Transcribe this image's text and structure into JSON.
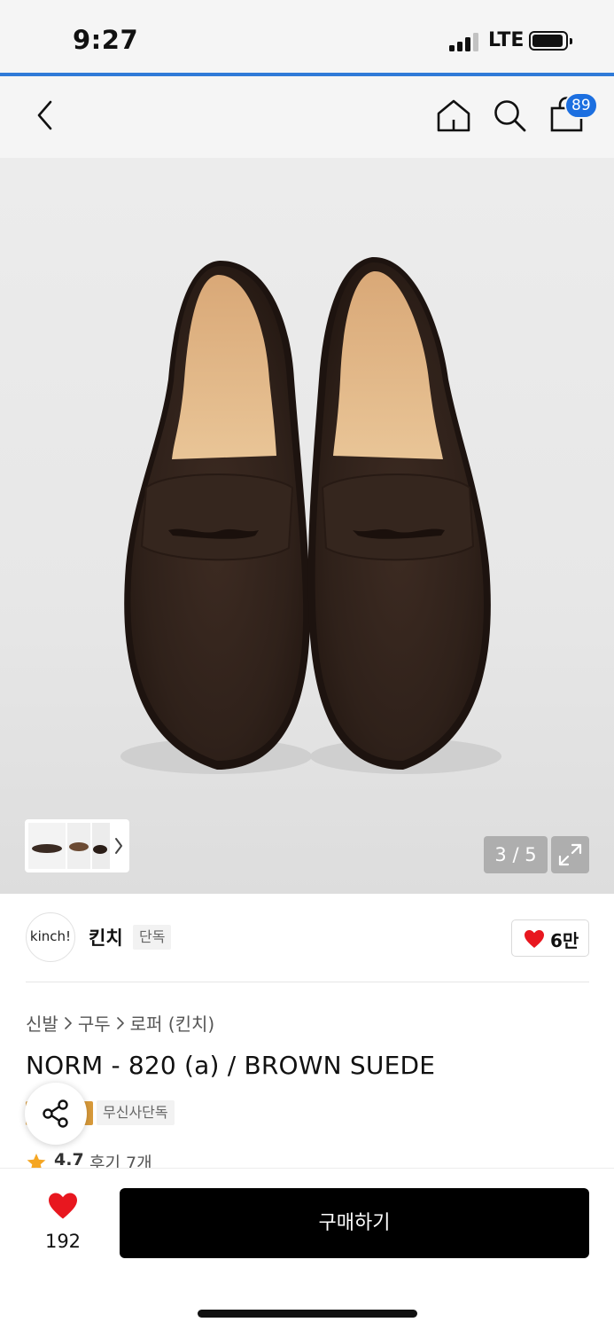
{
  "status_bar": {
    "time": "9:27",
    "network": "LTE"
  },
  "nav": {
    "cart_count": "89"
  },
  "product_image": {
    "counter": "3 / 5"
  },
  "brand": {
    "logo_text": "kinch!",
    "name": "킨치",
    "exclusive_tag": "단독",
    "likes": "6만"
  },
  "breadcrumb": [
    "신발",
    "구두",
    "로퍼 (킨치)"
  ],
  "product": {
    "title": "NORM - 820 (a) / BROWN SUEDE",
    "tag_musinsa": "무신사단독",
    "rating": "4.7",
    "reviews": "후기 7개"
  },
  "bottom_bar": {
    "wish_count": "192",
    "buy_label": "구매하기"
  },
  "colors": {
    "accent": "#1c6fe0",
    "heart": "#e8171f",
    "buy_button": "#000000",
    "tag_orange": "#d89a3a",
    "star": "#f5a623"
  },
  "icons": [
    "back-arrow-icon",
    "home-icon",
    "search-icon",
    "shopping-bag-icon",
    "chevron-right-icon",
    "expand-icon",
    "heart-icon",
    "share-icon",
    "star-icon"
  ]
}
